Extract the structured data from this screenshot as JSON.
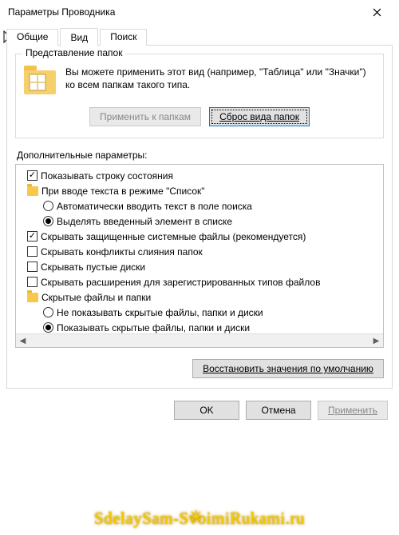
{
  "window": {
    "title": "Параметры Проводника"
  },
  "tabs": {
    "general": "Общие",
    "view": "Вид",
    "search": "Поиск"
  },
  "group": {
    "legend": "Представление папок",
    "text": "Вы можете применить этот вид (например, \"Таблица\" или \"Значки\") ко всем папкам такого типа.",
    "apply_btn": "Применить к папкам",
    "reset_btn": "Сброс вида папок"
  },
  "adv_label": "Дополнительные параметры:",
  "tree": {
    "r0": "Показывать строку состояния",
    "r1": "При вводе текста в режиме \"Список\"",
    "r2": "Автоматически вводить текст в поле поиска",
    "r3": "Выделять введенный элемент в списке",
    "r4": "Скрывать защищенные системные файлы (рекомендуется)",
    "r5": "Скрывать конфликты слияния папок",
    "r6": "Скрывать пустые диски",
    "r7": "Скрывать расширения для зарегистрированных типов файлов",
    "r8": "Скрытые файлы и папки",
    "r9": "Не показывать скрытые файлы, папки и диски",
    "r10": "Показывать скрытые файлы, папки и диски"
  },
  "restore_btn": "Восстановить значения по умолчанию",
  "buttons": {
    "ok": "OK",
    "cancel": "Отмена",
    "apply": "Применить"
  },
  "watermark": "SdelaySam-SvoimiRukami.ru"
}
